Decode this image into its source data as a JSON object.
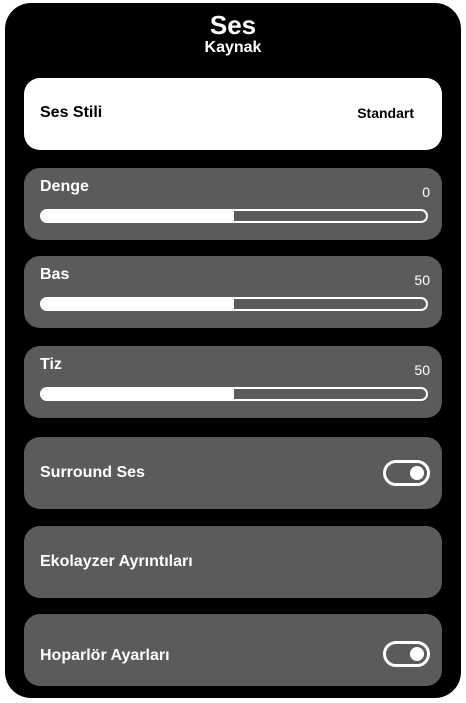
{
  "header": {
    "title": "Ses",
    "subtitle": "Kaynak"
  },
  "items": {
    "sound_style": {
      "label": "Ses Stili",
      "value": "Standart"
    },
    "balance": {
      "label": "Denge",
      "value": "0",
      "level_percent": 50
    },
    "bass": {
      "label": "Bas",
      "value": "50",
      "level_percent": 50
    },
    "treble": {
      "label": "Tiz",
      "value": "50",
      "level_percent": 50
    },
    "surround": {
      "label": "Surround Ses",
      "toggle_on": true
    },
    "equalizer": {
      "label": "Ekolayzer Ayrıntıları"
    },
    "speakers": {
      "label": "Hoparlör Ayarları",
      "toggle_on": true
    }
  },
  "colors": {
    "background": "#000000",
    "item_bg": "#5b5b5b",
    "selected_bg": "#ffffff",
    "text": "#ffffff",
    "selected_text": "#000000"
  },
  "icons": {
    "toggle": "toggle-switch-icon"
  }
}
